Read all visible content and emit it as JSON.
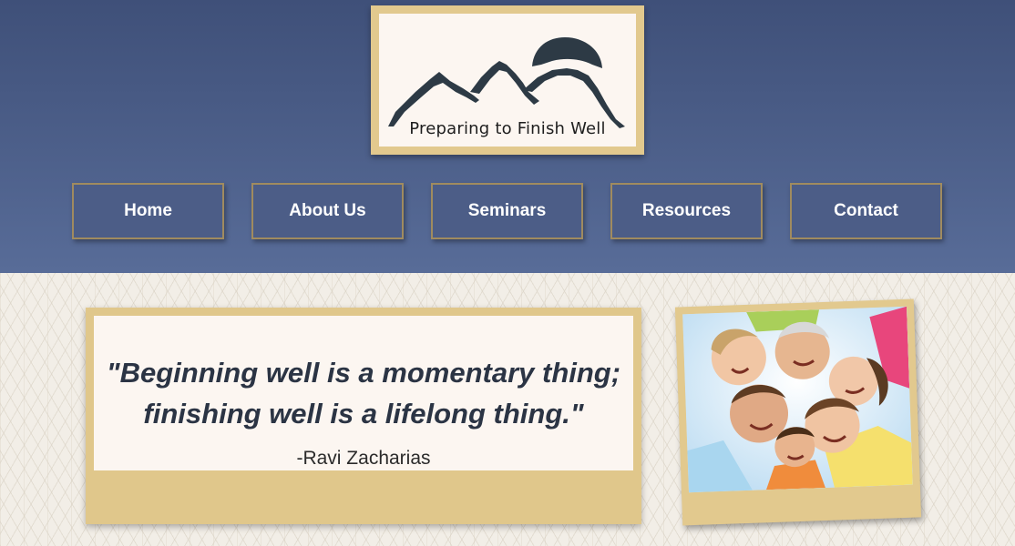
{
  "logo": {
    "text": "Preparing to Finish Well",
    "icon": "mountain-sun-logo"
  },
  "nav": {
    "items": [
      {
        "label": "Home"
      },
      {
        "label": "About Us"
      },
      {
        "label": "Seminars"
      },
      {
        "label": "Resources"
      },
      {
        "label": "Contact"
      }
    ]
  },
  "quote": {
    "line1": "\"Beginning well is a momentary thing;",
    "line2": "finishing well is a lifelong thing.\"",
    "author": "-Ravi Zacharias"
  },
  "photo": {
    "subject": "family-circle-photo"
  },
  "colors": {
    "header_top": "#3f5079",
    "header_bottom": "#586c98",
    "nav_button": "#4c5d87",
    "frame_gold": "#e2c98e",
    "card_cream": "#fcf6f1",
    "quote_text": "#2b3444"
  }
}
